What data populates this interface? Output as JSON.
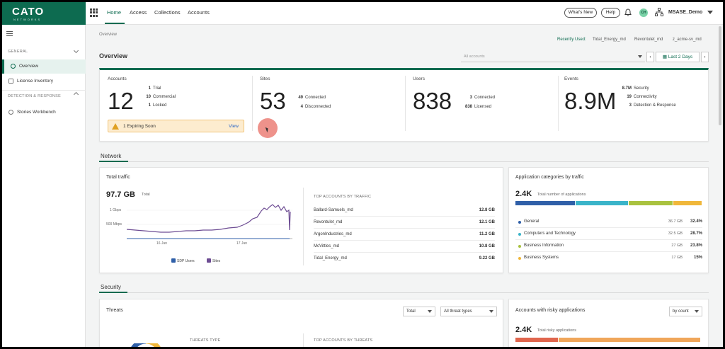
{
  "topbar": {
    "logo": "CATO",
    "logo_sub": "NETWORKS",
    "tabs": [
      "Home",
      "Access",
      "Collections",
      "Accounts"
    ],
    "whats_new": "What's New",
    "help": "Help",
    "avatar_initials": "CH",
    "account_name": "MSASE_Demo",
    "brand_color": "#0d6b50"
  },
  "sidebar": {
    "section_general": "GENERAL",
    "item_overview": "Overview",
    "item_license": "License Inventory",
    "section_detection": "DETECTION & RESPONSE",
    "item_stories": "Stories Workbench"
  },
  "main": {
    "breadcrumb": "Overview",
    "recently_used_label": "Recently Used:",
    "recent": [
      "Tidal_Energy_md",
      "Revontulet_md",
      "z_acme-sv_md"
    ],
    "title": "Overview",
    "accounts_placeholder": "All accounts",
    "period": "Last 2 Days"
  },
  "overview": {
    "accounts": {
      "label": "Accounts",
      "value": "12",
      "lines": [
        [
          "1",
          "Trial"
        ],
        [
          "10",
          "Commercial"
        ],
        [
          "1",
          "Locked"
        ]
      ]
    },
    "warning": {
      "text": "1 Expiring Soon",
      "link": "View"
    },
    "sites": {
      "label": "Sites",
      "value": "53",
      "lines": [
        [
          "49",
          "Connected"
        ],
        [
          "4",
          "Disconnected"
        ]
      ]
    },
    "users": {
      "label": "Users",
      "value": "838",
      "lines": [
        [
          "3",
          "Connected"
        ],
        [
          "838",
          "Licensed"
        ]
      ]
    },
    "events": {
      "label": "Events",
      "value": "8.9M",
      "lines": [
        [
          "8.7M",
          "Security"
        ],
        [
          "19",
          "Connectivity"
        ],
        [
          "3",
          "Detection & Response"
        ]
      ]
    }
  },
  "network": {
    "section": "Network",
    "traffic": {
      "title": "Total traffic",
      "total": "97.7 GB",
      "total_label": "Total",
      "y_ticks": [
        "1 Gbps",
        "500 Mbps"
      ],
      "x_ticks": [
        "16 Jun",
        "17 Jun"
      ],
      "legend": [
        "SDP Users",
        "Sites"
      ],
      "top_header": "TOP ACCOUNTS BY TRAFFIC",
      "top": [
        [
          "Ballard-Samuels_md",
          "12.8 GB"
        ],
        [
          "Revontulet_md",
          "12.1 GB"
        ],
        [
          "ArgonIndustries_md",
          "11.2 GB"
        ],
        [
          "McVittles_md",
          "10.8 GB"
        ],
        [
          "Tidal_Energy_md",
          "9.22 GB"
        ]
      ]
    },
    "categories": {
      "title": "Application categories by traffic",
      "total": "2.4K",
      "total_label": "Total number of applications",
      "colors": [
        "#2f5fa8",
        "#3ab4c9",
        "#a9c23f",
        "#f0b73a"
      ],
      "items": [
        [
          "General",
          "36.7 GB",
          "32.4%"
        ],
        [
          "Computers and Technology",
          "32.5 GB",
          "28.7%"
        ],
        [
          "Business Information",
          "27 GB",
          "23.8%"
        ],
        [
          "Business Systems",
          "17 GB",
          "15%"
        ]
      ]
    }
  },
  "security": {
    "section": "Security",
    "threats": {
      "title": "Threats",
      "filter_total": "Total",
      "filter_types": "All threat types",
      "col1": "THREATS TYPE",
      "col2": "TOP ACCOUNTS BY THREATS"
    },
    "risky": {
      "title": "Accounts with risky applications",
      "filter": "by count",
      "total": "2.4K",
      "total_label": "Total risky applications",
      "colors": [
        "#e0664e",
        "#f0a65a"
      ]
    }
  }
}
